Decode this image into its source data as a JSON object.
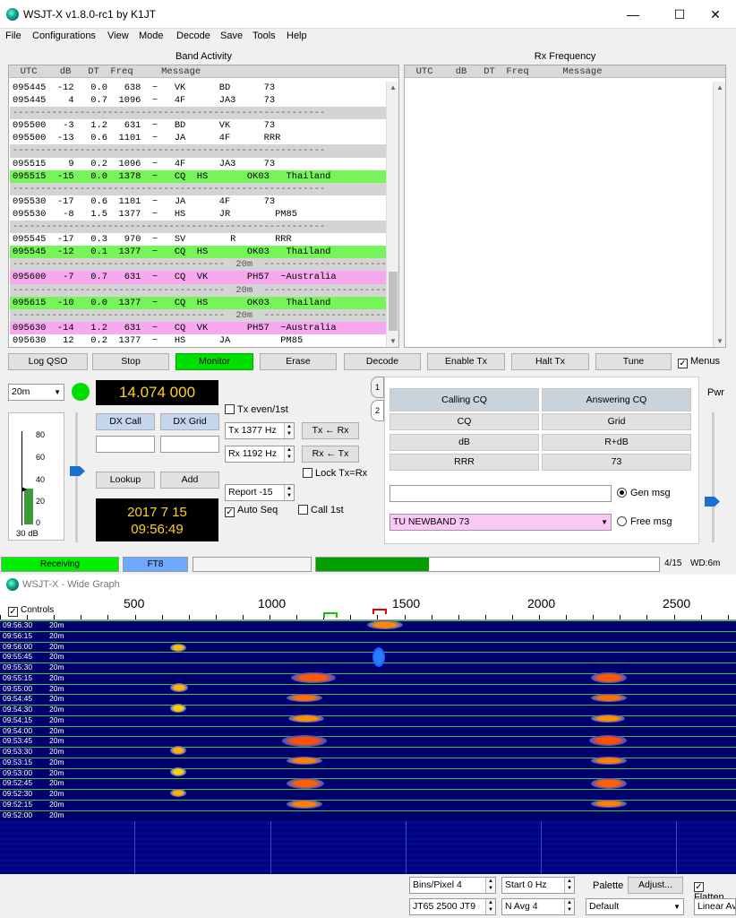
{
  "window": {
    "title": "WSJT-X   v1.8.0-rc1   by K1JT"
  },
  "menu": [
    "File",
    "Configurations",
    "View",
    "Mode",
    "Decode",
    "Save",
    "Tools",
    "Help"
  ],
  "band": {
    "title": "Band Activity",
    "header": "  UTC    dB   DT  Freq     Message",
    "rows": [
      {
        "t": "095445  -12   0.0   638  ~   VK      BD      73",
        "c": ""
      },
      {
        "t": "095445    4   0.7  1096  ~   4F      JA3     73",
        "c": ""
      },
      {
        "t": "--------------------------------------------------------",
        "c": "gray"
      },
      {
        "t": "095500   -3   1.2   631  ~   BD      VK      73",
        "c": ""
      },
      {
        "t": "095500  -13   0.6  1101  ~   JA      4F      RRR",
        "c": ""
      },
      {
        "t": "--------------------------------------------------------",
        "c": "gray"
      },
      {
        "t": "095515    9   0.2  1096  ~   4F      JA3     73",
        "c": ""
      },
      {
        "t": "095515  -15   0.0  1378  ~   CQ  HS       OK03   Thailand",
        "c": "g"
      },
      {
        "t": "--------------------------------------------------------",
        "c": "gray"
      },
      {
        "t": "095530  -17   0.6  1101  ~   JA      4F      73",
        "c": ""
      },
      {
        "t": "095530   -8   1.5  1377  ~   HS      JR        PM85",
        "c": ""
      },
      {
        "t": "--------------------------------------------------------",
        "c": "gray"
      },
      {
        "t": "095545  -17   0.3   970  ~   SV        R       RRR",
        "c": ""
      },
      {
        "t": "095545  -12   0.1  1377  ~   CQ  HS       OK03   Thailand",
        "c": "g"
      },
      {
        "t": "--------------------------------------  20m  ----------------------",
        "c": "gray"
      },
      {
        "t": "095600   -7   0.7   631  ~   CQ  VK       PH57  ~Australia",
        "c": "p"
      },
      {
        "t": "--------------------------------------  20m  ----------------------",
        "c": "gray"
      },
      {
        "t": "095615  -10   0.0  1377  ~   CQ  HS       OK03   Thailand",
        "c": "g"
      },
      {
        "t": "--------------------------------------  20m  ----------------------",
        "c": "gray"
      },
      {
        "t": "095630  -14   1.2   631  ~   CQ  VK       PH57  ~Australia",
        "c": "p"
      },
      {
        "t": "095630   12   0.2  1377  ~   HS      JA         PM85",
        "c": ""
      }
    ]
  },
  "rx": {
    "title": "Rx Frequency",
    "header": "  UTC    dB   DT  Freq      Message"
  },
  "buttons": {
    "log_qso": "Log QSO",
    "stop": "Stop",
    "monitor": "Monitor",
    "erase": "Erase",
    "decode": "Decode",
    "enable_tx": "Enable Tx",
    "halt_tx": "Halt Tx",
    "tune": "Tune",
    "menus": "Menus"
  },
  "controls": {
    "band": "20m",
    "freq": "14.074 000",
    "tx_even": "Tx even/1st",
    "tx_hz": "Tx   1377  Hz",
    "rx_hz": "Rx   1192  Hz",
    "tx_from_rx": "Tx ← Rx",
    "rx_from_tx": "Rx ← Tx",
    "lock": "Lock Tx=Rx",
    "report": "Report  -15",
    "auto_seq": "Auto Seq",
    "call_1st": "Call 1st",
    "dx_call": "DX Call",
    "dx_grid": "DX Grid",
    "lookup": "Lookup",
    "add": "Add",
    "date": "2017 7 15",
    "time": "09:56:49",
    "db": "30 dB",
    "pwr": "Pwr",
    "meter_ticks": [
      "80",
      "60",
      "40",
      "20",
      "0"
    ]
  },
  "msgs": {
    "tab1": "1",
    "tab2": "2",
    "calling": "Calling CQ",
    "answering": "Answering CQ",
    "cells": [
      "CQ",
      "Grid",
      "dB",
      "R+dB",
      "RRR",
      "73"
    ],
    "gen_msg": "Gen msg",
    "free_msg": "Free msg",
    "free_text": "TU NEWBAND 73"
  },
  "status": {
    "receiving": "Receiving",
    "mode": "FT8",
    "progress": 0.33,
    "count": "4/15",
    "wd": "WD:6m"
  },
  "wide": {
    "title": "WSJT-X - Wide Graph",
    "controls": "Controls",
    "ticks": [
      "500",
      "1000",
      "1500",
      "2000",
      "2500"
    ],
    "times": [
      "09:56:30",
      "09:56:15",
      "09:56:00",
      "09:55:45",
      "09:55:30",
      "09:55:15",
      "09:55:00",
      "09:54:45",
      "09:54:30",
      "09:54:15",
      "09:54:00",
      "09:53:45",
      "09:53:30",
      "09:53:15",
      "09:53:00",
      "09:52:45",
      "09:52:30",
      "09:52:15",
      "09:52:00"
    ],
    "band_lbl": "20m",
    "bins": "Bins/Pixel  4",
    "start": "Start  0 Hz",
    "palette": "Palette",
    "adjust": "Adjust...",
    "flatten": "Flatten",
    "mode_sel": "JT65   2500   JT9",
    "navg": "N Avg  4",
    "palette_sel": "Default",
    "linear": "Linear Av"
  },
  "colors": {
    "green": "#76f55a",
    "pink": "#f7a8f0",
    "wf_bg": "#00006e"
  }
}
